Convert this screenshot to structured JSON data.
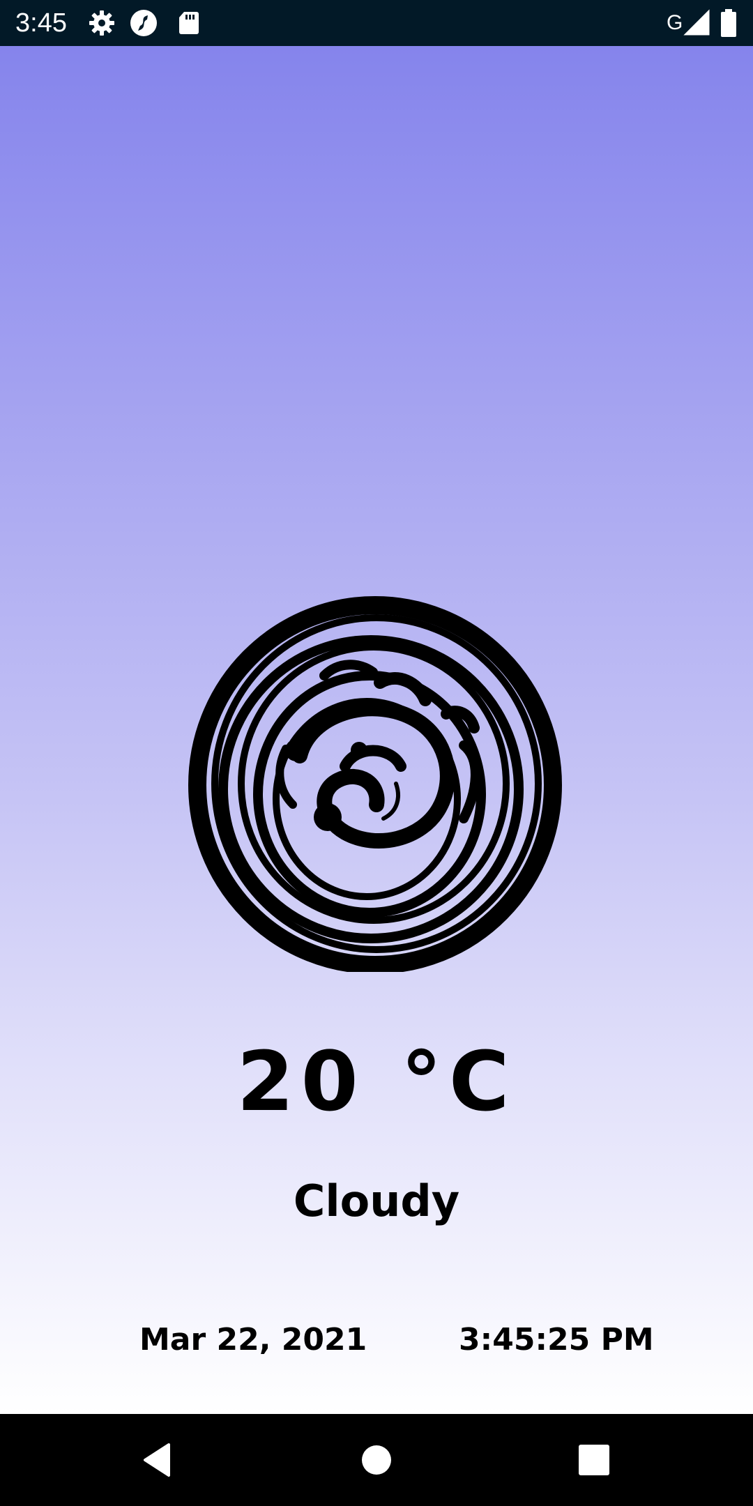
{
  "status_bar": {
    "time": "3:45",
    "network_type": "G",
    "icons": [
      "gear-icon",
      "sync-icon",
      "sd-card-icon",
      "signal-icon",
      "battery-icon"
    ]
  },
  "weather": {
    "icon": "cloudy-swirl-icon",
    "temperature": "20 °C",
    "condition": "Cloudy",
    "date": "Mar 22, 2021",
    "time": "3:45:25 PM"
  },
  "nav_bar": {
    "icons": [
      "back-icon",
      "home-icon",
      "recents-icon"
    ]
  },
  "colors": {
    "status_bar_bg": "#021927",
    "gradient_top": "#8584ec",
    "gradient_bottom": "#ffffff",
    "text": "#000000",
    "nav_bar_bg": "#000000"
  }
}
